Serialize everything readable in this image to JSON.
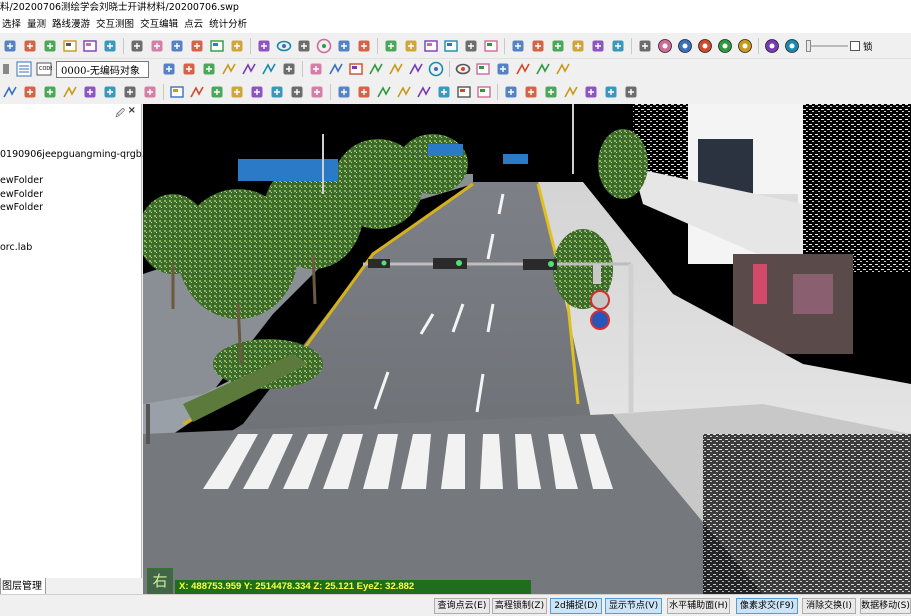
{
  "window": {
    "title": "料/20200706测绘学会刘晓士开讲材料/20200706.swp"
  },
  "menu": [
    "选择",
    "量测",
    "路线漫游",
    "交互测图",
    "交互编辑",
    "点云",
    "统计分析"
  ],
  "toolbar2": {
    "code_combo_value": "0000-无编码对象"
  },
  "toolbar1": {
    "check_label": "锁"
  },
  "toolbar1_icons": [
    "new-icon",
    "open-icon",
    "edit-icon",
    "window-icon",
    "view-icon",
    "key-value-icon",
    "info-icon",
    "value-icon",
    "link-icon",
    "vertex-icon",
    "extent-icon",
    "tools-icon",
    "tree-icon",
    "eye-icon",
    "terrain-icon",
    "sun-icon",
    "goggles-icon",
    "pointer-icon",
    "brush-icon",
    "pick-icon",
    "image-icon",
    "table-icon",
    "channel-icon",
    "grid-icon",
    "cube-icon",
    "folder-icon",
    "chart-icon",
    "mountain-icon",
    "measure-icon",
    "tower-icon",
    "bucket-icon",
    "sync-icon",
    "globe-icon",
    "globe-layer-icon",
    "globe-edit-icon",
    "ring-icon",
    "ring-alt-icon",
    "ring-red-icon"
  ],
  "toolbar2_icons": [
    "cursor-icon",
    "layer-stack-icon",
    "code-list-icon",
    "crosshair-icon",
    "angle-icon",
    "polyline-icon",
    "polygon-icon",
    "parallelogram-icon",
    "rectangle-icon",
    "text-box-icon",
    "freehand-icon",
    "arrow-icon",
    "arc-icon",
    "circle-icon",
    "ellipse-icon",
    "fence-icon",
    "vertex-add-icon",
    "cross-line-icon",
    "line-split-icon",
    "line-dot-icon"
  ],
  "toolbar3_icons": [
    "line-icon",
    "move-icon",
    "copy-icon",
    "wave-icon",
    "branch-icon",
    "rotate-icon",
    "skip-icon",
    "transform-icon",
    "frame-icon",
    "split-icon",
    "merge-icon",
    "group-icon",
    "node-icon",
    "point-r-icon",
    "point-f-icon",
    "connect-icon",
    "xoy-icon",
    "fit-icon",
    "hline-icon",
    "edge-icon",
    "hierarchy-icon",
    "mesh-icon",
    "wall-icon",
    "bar-icon",
    "fill-icon",
    "sigma-icon",
    "z-up-icon",
    "angle-z-icon",
    "sort-icon",
    "join-icon",
    "layers-icon"
  ],
  "panel": {
    "tree": [
      "0190906jeepguangming-qrgb...",
      "ewFolder",
      "ewFolder",
      "ewFolder",
      "orc.lab"
    ],
    "tab": "图层管理"
  },
  "viewport": {
    "coord_readout": "X: 488753.959 Y: 2514478.334 Z: 25.121 EyeZ: 32.882",
    "marker_label": "右"
  },
  "statusbar": {
    "buttons": [
      {
        "label": "查询点云(E)",
        "active": false
      },
      {
        "label": "高程锁制(Z)",
        "active": false
      },
      {
        "label": "2d捕捉(D)",
        "active": true
      },
      {
        "label": "显示节点(V)",
        "active": true
      },
      {
        "label": "水平辅助面(H)",
        "active": false
      },
      {
        "label": "像素求交(F9)",
        "active": true
      },
      {
        "label": "消除交换(I)",
        "active": false
      },
      {
        "label": "数据移动(S)",
        "active": false
      }
    ]
  },
  "colors": {
    "coord_bg": "#1e6e1e",
    "coord_text": "#ffff40",
    "active_btn": "#cce4f7"
  }
}
